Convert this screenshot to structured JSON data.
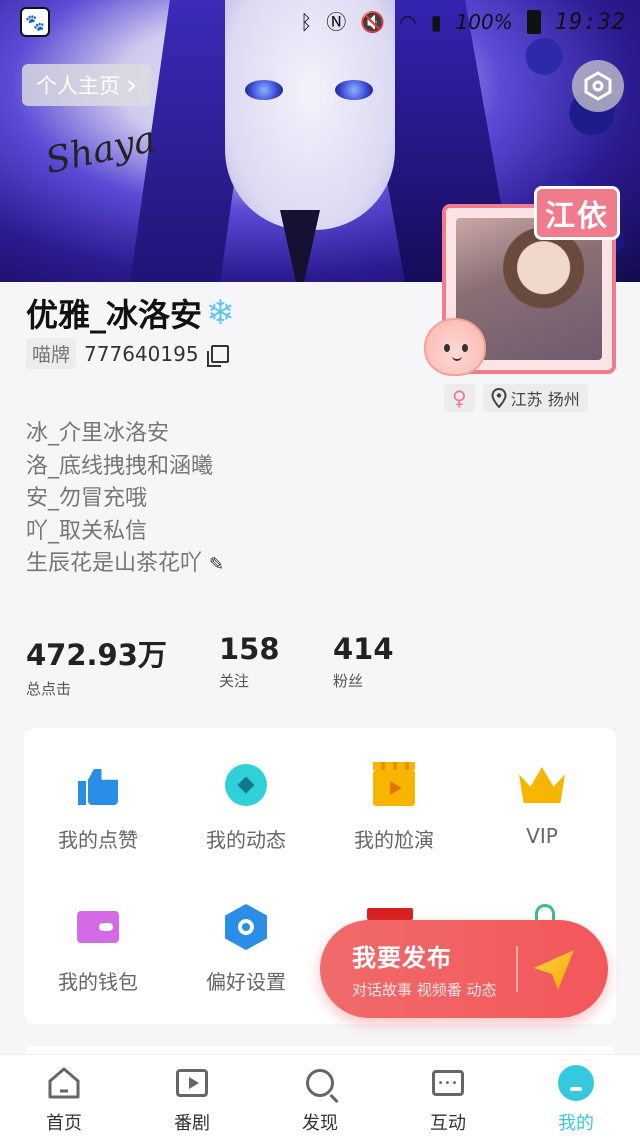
{
  "status_bar": {
    "battery_pct": "100%",
    "time": "19:32"
  },
  "header": {
    "homepage_label": "个人主页",
    "chevron": "›",
    "signature": "Shaya"
  },
  "profile": {
    "username": "优雅_冰洛安",
    "username_emoji": "❄",
    "id_label": "喵牌",
    "id_value": "777640195",
    "photo_tag": "江依",
    "location": "江苏 扬州",
    "gender_symbol": "♀",
    "bio": [
      "冰_介里冰洛安",
      "洛_底线拽拽和涵曦",
      "安_勿冒充哦",
      "吖_取关私信",
      "生辰花是山茶花吖"
    ]
  },
  "stats": [
    {
      "value": "472.93万",
      "label": "总点击"
    },
    {
      "value": "158",
      "label": "关注"
    },
    {
      "value": "414",
      "label": "粉丝"
    }
  ],
  "grid": {
    "items": [
      {
        "label": "我的点赞",
        "icon": "thumbs-up-icon"
      },
      {
        "label": "我的动态",
        "icon": "compass-icon"
      },
      {
        "label": "我的尬演",
        "icon": "clapperboard-icon"
      },
      {
        "label": "VIP",
        "icon": "crown-icon"
      },
      {
        "label": "我的钱包",
        "icon": "wallet-icon"
      },
      {
        "label": "偏好设置",
        "icon": "hexagon-settings-icon"
      }
    ]
  },
  "fab": {
    "title": "我要发布",
    "subtitle": "对话故事 视频番 动态"
  },
  "bottom_nav": [
    {
      "label": "首页",
      "icon": "home-icon"
    },
    {
      "label": "番剧",
      "icon": "play-box-icon"
    },
    {
      "label": "发现",
      "icon": "search-icon"
    },
    {
      "label": "互动",
      "icon": "chat-bubble-icon"
    },
    {
      "label": "我的",
      "icon": "profile-icon",
      "active": true
    }
  ],
  "colors": {
    "accent": "#35c9dd",
    "fab": "#f3575b",
    "photo_frame": "#f07b8c"
  }
}
